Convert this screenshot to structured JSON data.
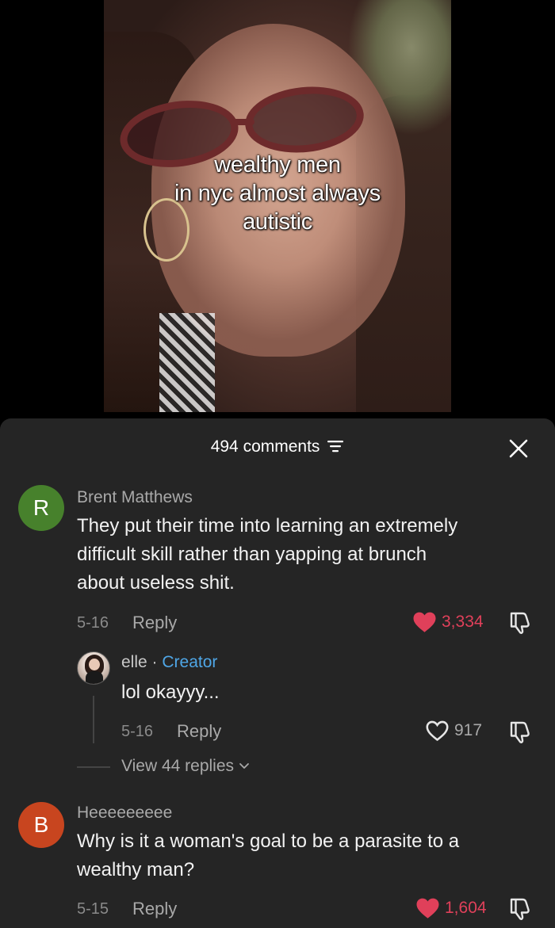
{
  "video": {
    "caption_lines": [
      "wealthy men",
      "in nyc almost always",
      "autistic"
    ]
  },
  "comments_header": {
    "count_label": "494 comments",
    "sort_icon": "sort-lines-icon",
    "close_icon": "close-x-icon"
  },
  "comments": [
    {
      "avatar_letter": "R",
      "avatar_color": "#47812c",
      "username": "Brent Matthews",
      "text_lines": [
        "They put their time into learning an extremely",
        "difficult skill rather than yapping at brunch",
        "about useless shit."
      ],
      "date": "5-16",
      "reply_label": "Reply",
      "likes": "3,334",
      "liked": true
    },
    {
      "avatar_letter": "B",
      "avatar_color": "#c8451f",
      "username": "Heeeeeeeee",
      "text_lines": [
        "Why is it a woman's goal to be a parasite to a",
        "wealthy man?"
      ],
      "date": "5-15",
      "reply_label": "Reply",
      "likes": "1,604",
      "liked": true
    }
  ],
  "reply": {
    "username": "elle",
    "separator": "·",
    "creator_label": "Creator",
    "text": "lol okayyy...",
    "date": "5-16",
    "reply_label": "Reply",
    "likes": "917",
    "liked": false
  },
  "view_replies_label": "View 44 replies",
  "colors": {
    "panel_bg": "#252525",
    "like_red": "#e0405a",
    "creator_blue": "#4fa6e6"
  }
}
